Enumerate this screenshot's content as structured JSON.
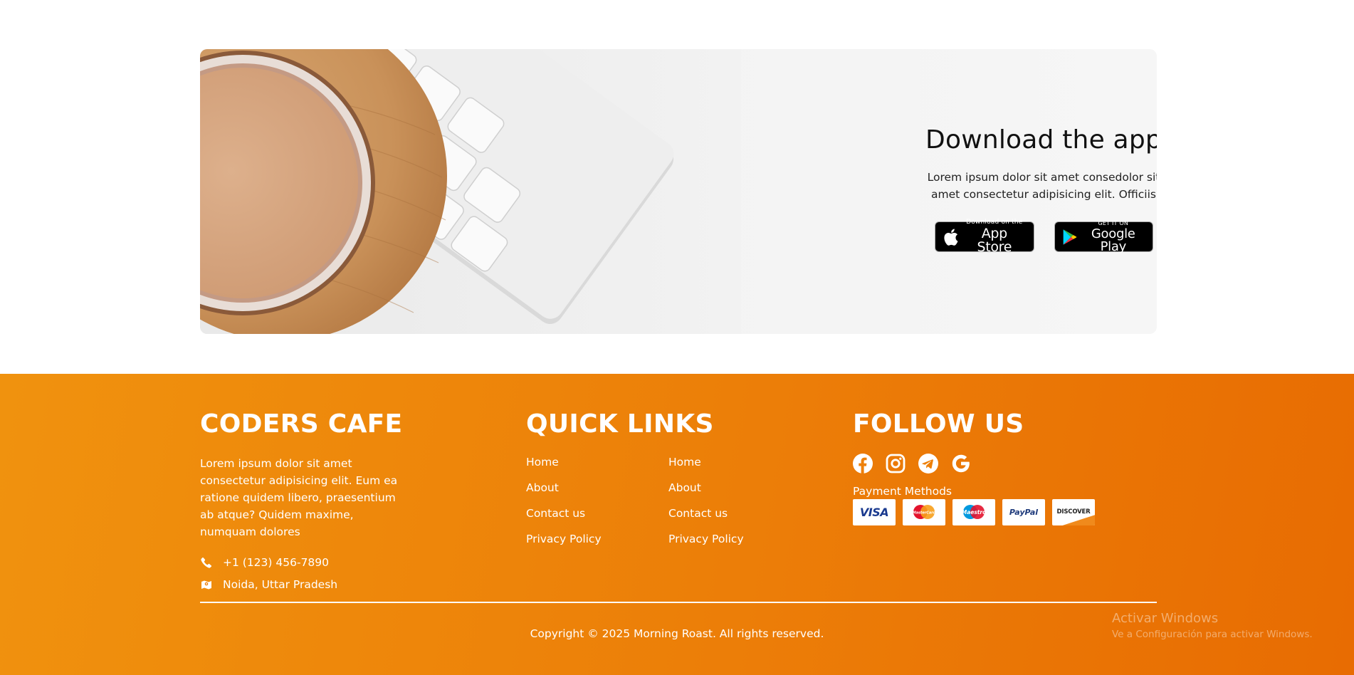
{
  "app_banner": {
    "title": "Download the app",
    "description": "Lorem ipsum dolor sit amet consedolor sit amet consectetur adipisicing elit. Officiis",
    "app_store": {
      "small": "Download on the",
      "big": "App Store"
    },
    "google_play": {
      "small": "GET IT ON",
      "big": "Google Play"
    }
  },
  "footer": {
    "brand": {
      "heading": "CODERS CAFE",
      "description": "Lorem ipsum dolor sit amet consectetur adipisicing elit. Eum ea ratione quidem libero, praesentium ab atque? Quidem maxime, numquam dolores",
      "phone": "+1 (123) 456-7890",
      "location": "Noida, Uttar Pradesh"
    },
    "quick_links": {
      "heading": "QUICK LINKS",
      "col1": [
        "Home",
        "About",
        "Contact us",
        "Privacy Policy"
      ],
      "col2": [
        "Home",
        "About",
        "Contact us",
        "Privacy Policy"
      ]
    },
    "follow": {
      "heading": "FOLLOW US",
      "socials": [
        "facebook-icon",
        "instagram-icon",
        "telegram-icon",
        "google-icon"
      ],
      "payment_label": "Payment Methods",
      "payments": [
        "VISA",
        "MasterCard",
        "Maestro",
        "PayPal",
        "DISCOVER"
      ]
    },
    "copyright": "Copyright © 2025 Morning Roast. All rights reserved."
  },
  "watermark": {
    "title": "Activar Windows",
    "subtitle": "Ve a Configuración para activar Windows."
  },
  "colors": {
    "footer_start": "#f0920e",
    "footer_end": "#e86c02",
    "banner_bg": "#f2f2f2"
  }
}
